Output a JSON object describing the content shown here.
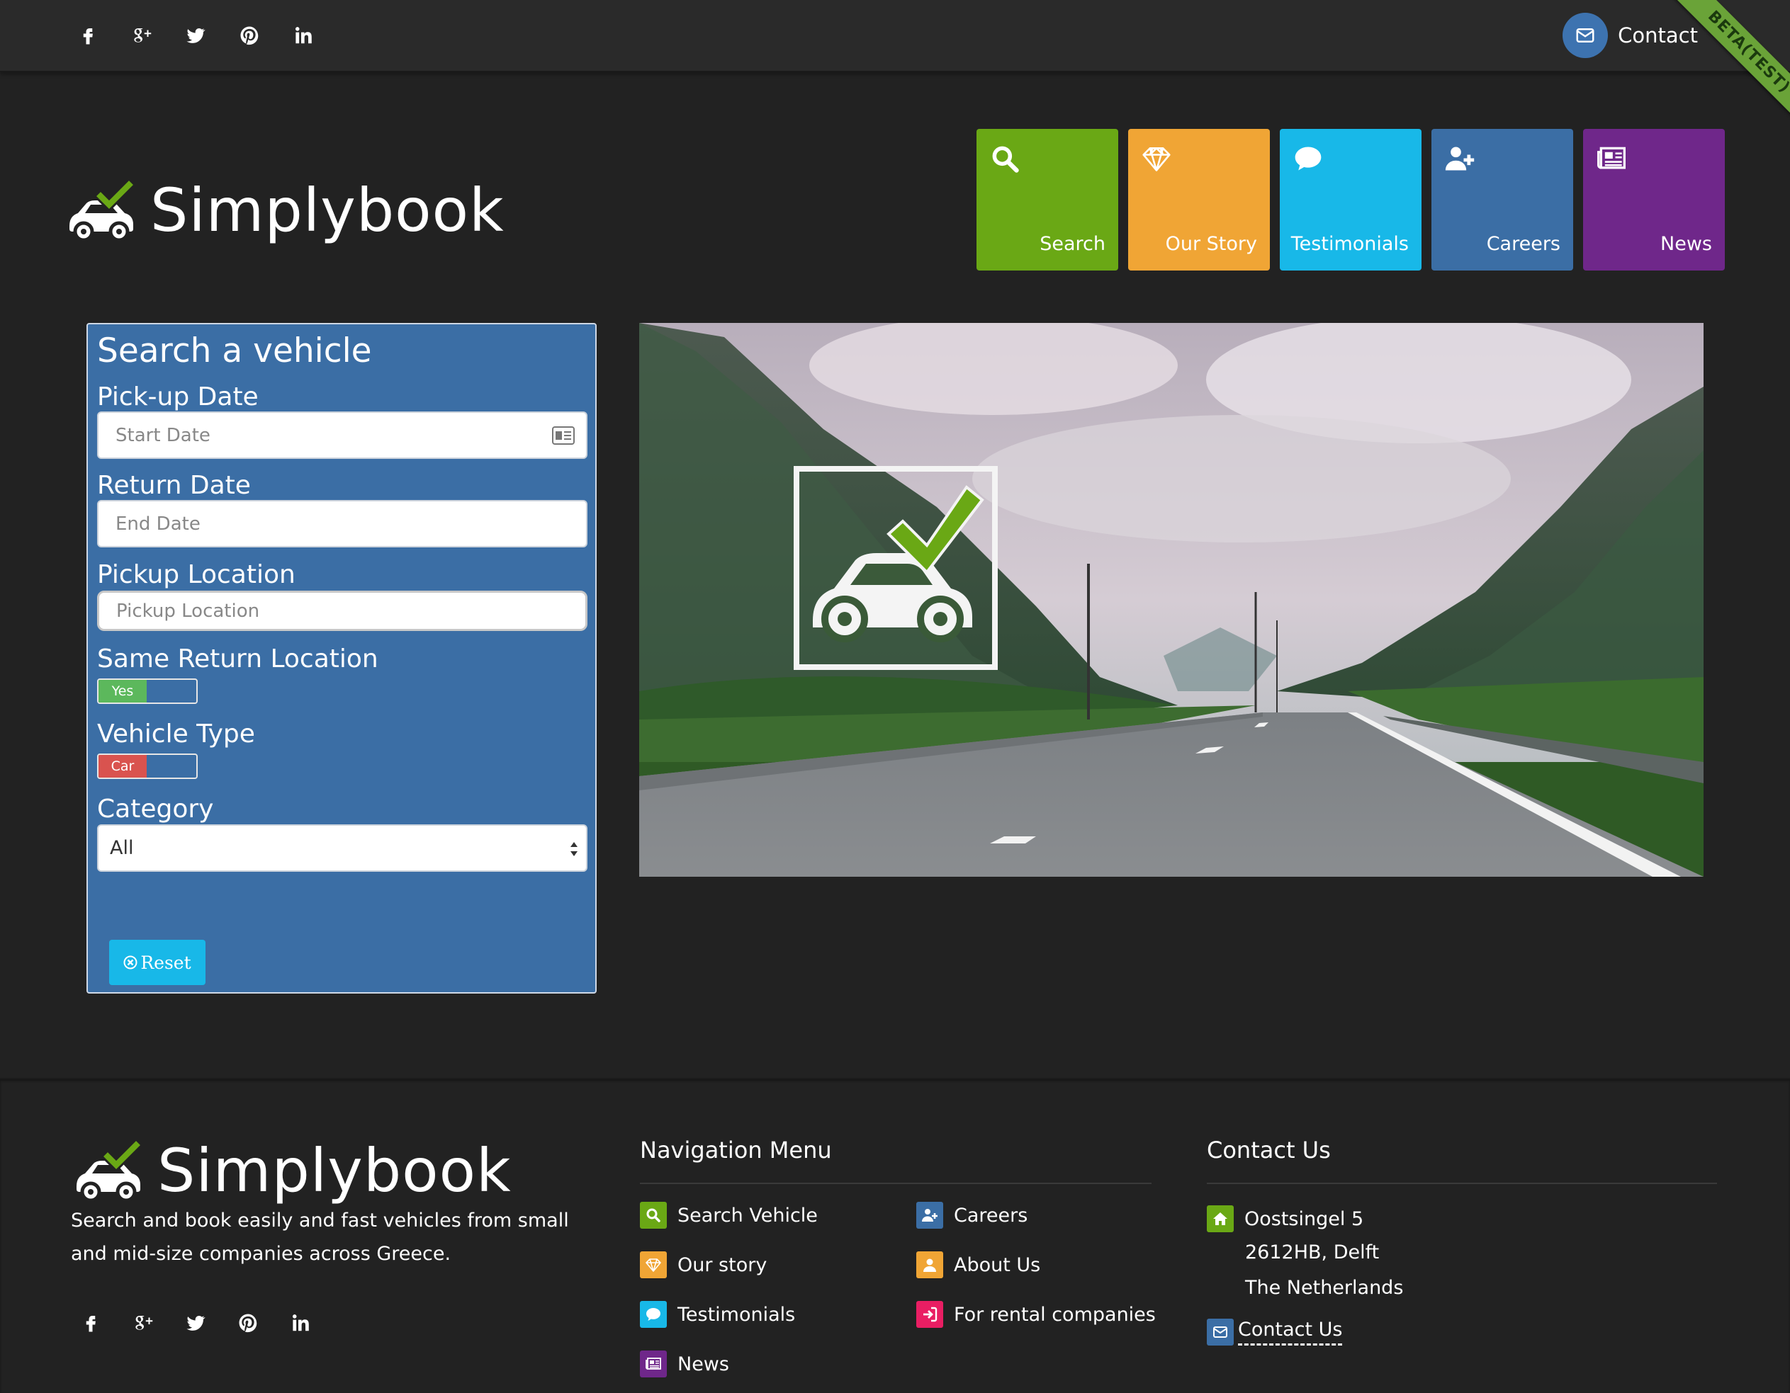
{
  "social_icons": [
    "facebook-icon",
    "google-plus-icon",
    "twitter-icon",
    "pinterest-icon",
    "linkedin-icon"
  ],
  "header": {
    "contact_label": "Contact",
    "beta_ribbon": "BETA(TEST)"
  },
  "brand": {
    "name": "Simplybook"
  },
  "tiles": [
    {
      "label": "Search",
      "icon": "search-icon",
      "color": "#6aa815"
    },
    {
      "label": "Our Story",
      "icon": "diamond-icon",
      "color": "#f0a535"
    },
    {
      "label": "Testimonials",
      "icon": "comment-icon",
      "color": "#18b8e8"
    },
    {
      "label": "Careers",
      "icon": "user-plus-icon",
      "color": "#3b6ea5"
    },
    {
      "label": "News",
      "icon": "newspaper-icon",
      "color": "#6f278a"
    }
  ],
  "search_form": {
    "title": "Search a vehicle",
    "pickup_date_label": "Pick-up Date",
    "pickup_date_placeholder": "Start Date",
    "return_date_label": "Return Date",
    "return_date_placeholder": "End Date",
    "pickup_location_label": "Pickup Location",
    "pickup_location_placeholder": "Pickup Location",
    "same_return_label": "Same Return Location",
    "same_return_value": "Yes",
    "vehicle_type_label": "Vehicle Type",
    "vehicle_type_value": "Car",
    "category_label": "Category",
    "category_value": "All",
    "reset_label": "Reset"
  },
  "footer": {
    "brand": "Simplybook",
    "description": "Search and book easily and fast vehicles from small and mid-size companies across Greece.",
    "nav_title": "Navigation Menu",
    "nav_items": [
      {
        "label": "Search Vehicle",
        "icon": "search-icon",
        "color": "#6aa815"
      },
      {
        "label": "Careers",
        "icon": "user-plus-icon",
        "color": "#3b6ea5"
      },
      {
        "label": "Our story",
        "icon": "diamond-icon",
        "color": "#f0a535"
      },
      {
        "label": "About Us",
        "icon": "user-icon",
        "color": "#f0a535"
      },
      {
        "label": "Testimonials",
        "icon": "comment-icon",
        "color": "#18b8e8"
      },
      {
        "label": "For rental companies",
        "icon": "sign-in-icon",
        "color": "#e91e63"
      },
      {
        "label": "News",
        "icon": "newspaper-icon",
        "color": "#6f278a"
      }
    ],
    "contact_title": "Contact Us",
    "address_line1": "Oostsingel 5",
    "address_line2": "2612HB, Delft",
    "address_line3": "The Netherlands",
    "contact_link": "Contact Us"
  }
}
